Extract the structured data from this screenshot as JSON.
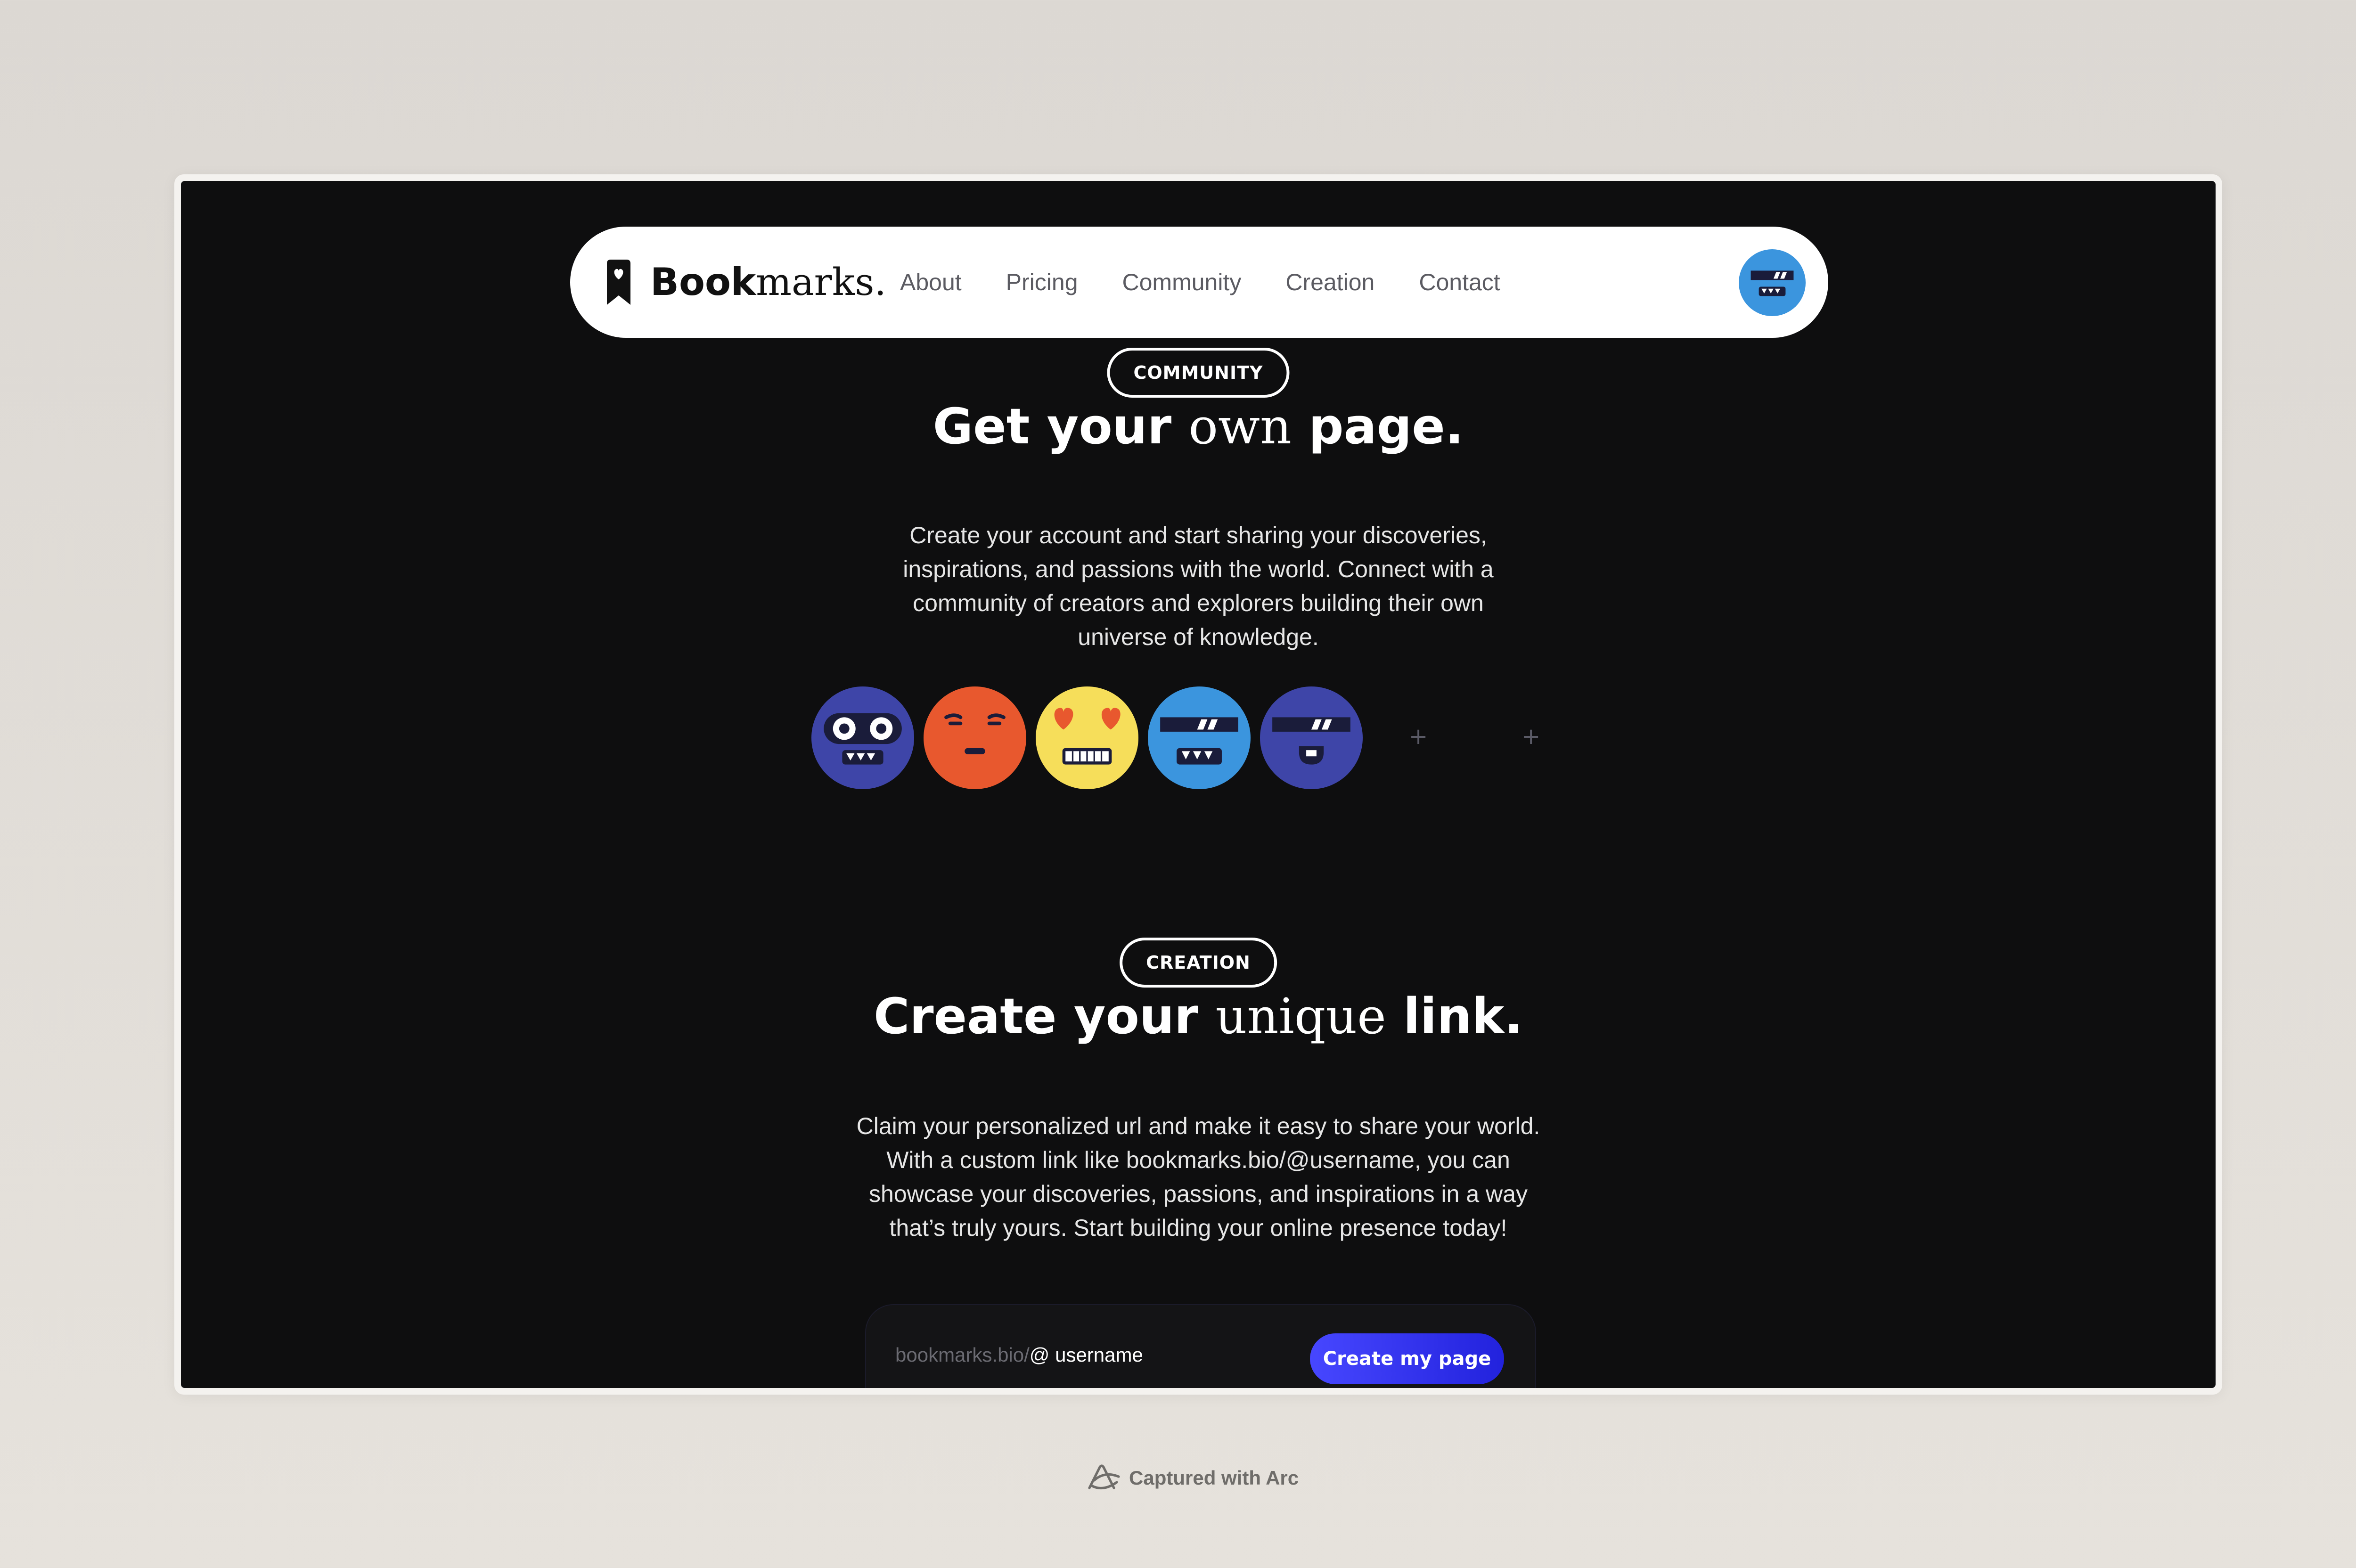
{
  "nav": {
    "brand_bold": "Book",
    "brand_serif": "marks.",
    "links": [
      "About",
      "Pricing",
      "Community",
      "Creation",
      "Contact"
    ]
  },
  "community": {
    "tag": "COMMUNITY",
    "heading_start": "Get your ",
    "heading_serif": "own",
    "heading_end": " page.",
    "description": "Create your account and start sharing your discoveries, inspirations, and passions with the world. Connect with a community of creators and explorers building their own universe of knowledge.",
    "avatars": [
      "robot-face-icon",
      "squint-face-icon",
      "heart-eyes-face-icon",
      "visor-face-icon",
      "visor-tongue-face-icon"
    ],
    "plus_1": "+",
    "plus_2": "+"
  },
  "creation": {
    "tag": "CREATION",
    "heading_start": "Create your ",
    "heading_serif": "unique",
    "heading_end": " link.",
    "description": "Claim your personalized url and make it easy to share your world. With a custom link like bookmarks.bio/@username, you can showcase your discoveries, passions, and inspirations in a way that’s truly yours. Start building your online presence today!",
    "link_prefix": "bookmarks.bio/",
    "username_placeholder": "@ username",
    "cta": "Create my page"
  },
  "footer": {
    "captured": "Captured with Arc"
  },
  "colors": {
    "background": "#0e0e0f",
    "accent": "#3a3af0",
    "blue_face": "#3b95de",
    "indigo_face": "#3e45a8",
    "orange_face": "#e8582e",
    "yellow_face": "#f6de5a"
  }
}
